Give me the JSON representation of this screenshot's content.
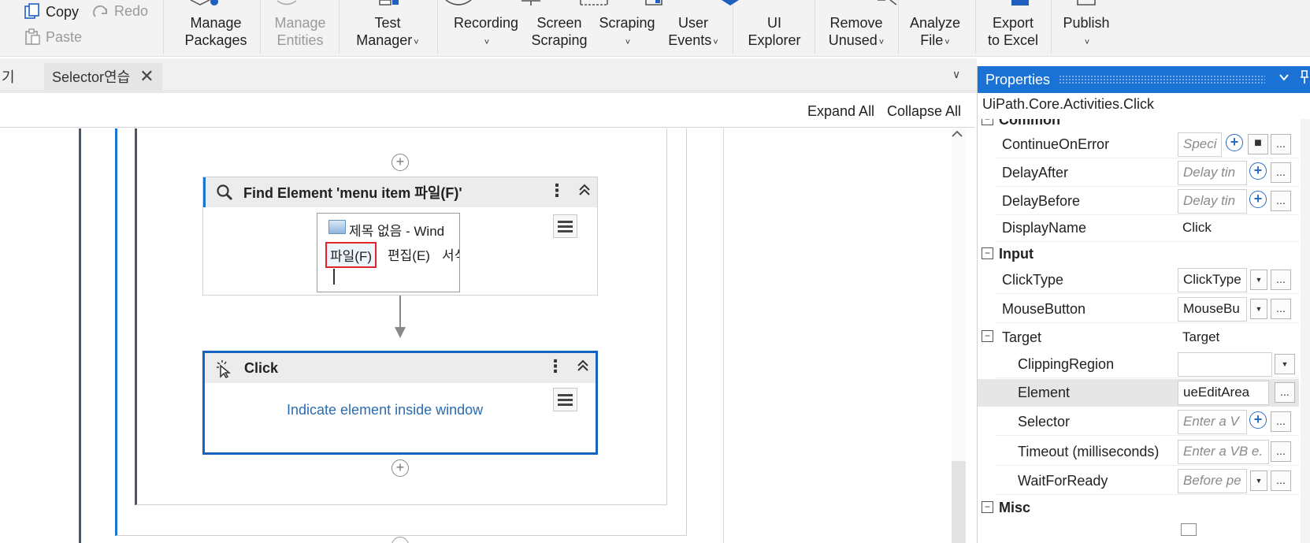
{
  "ribbon": {
    "copy": "Copy",
    "redo": "Redo",
    "paste": "Paste",
    "buttons": [
      {
        "line1": "Manage",
        "line2": "Packages",
        "caret": ""
      },
      {
        "line1": "Manage",
        "line2": "Entities",
        "caret": ""
      },
      {
        "line1": "Test",
        "line2": "Manager",
        "caret": "˅"
      },
      {
        "line1": "Recording",
        "line2": "",
        "caret": "˅"
      },
      {
        "line1": "Screen",
        "line2": "Scraping",
        "caret": ""
      },
      {
        "line1": "Scraping",
        "line2": "",
        "caret": "˅"
      },
      {
        "line1": "User",
        "line2": "Events",
        "caret": "˅"
      },
      {
        "line1": "UI",
        "line2": "Explorer",
        "caret": ""
      },
      {
        "line1": "Remove",
        "line2": "Unused",
        "caret": "˅"
      },
      {
        "line1": "Analyze",
        "line2": "File",
        "caret": "˅"
      },
      {
        "line1": "Export",
        "line2": "to Excel",
        "caret": ""
      },
      {
        "line1": "Publish",
        "line2": "",
        "caret": "˅"
      }
    ]
  },
  "tabs": {
    "prev_partial": "기",
    "active": "Selector연습",
    "close_glyph": "✕",
    "dropdown_glyph": "∨"
  },
  "designer": {
    "expand_all": "Expand All",
    "collapse_all": "Collapse All",
    "find_element": {
      "title": "Find Element 'menu item  파일(F)'",
      "preview_window_title": "제목 없음 - Wind",
      "preview_menu_selected": "파일(F)",
      "preview_menu_item2": "편집(E)",
      "preview_menu_item3": "서식"
    },
    "click_activity": {
      "title": "Click",
      "indicate_link": "Indicate element inside window"
    }
  },
  "properties": {
    "panel_title": "Properties",
    "type_name": "UiPath.Core.Activities.Click",
    "categories": {
      "common": "Common",
      "input": "Input",
      "misc": "Misc"
    },
    "rows": {
      "continue_on_error": {
        "name": "ContinueOnError",
        "value": "Speci"
      },
      "delay_after": {
        "name": "DelayAfter",
        "value": "Delay tin"
      },
      "delay_before": {
        "name": "DelayBefore",
        "value": "Delay tin"
      },
      "display_name": {
        "name": "DisplayName",
        "value": "Click"
      },
      "click_type": {
        "name": "ClickType",
        "value": "ClickType"
      },
      "mouse_button": {
        "name": "MouseButton",
        "value": "MouseBu"
      },
      "target": {
        "name": "Target",
        "value": "Target"
      },
      "clipping_region": {
        "name": "ClippingRegion",
        "value": ""
      },
      "element": {
        "name": "Element",
        "value": "ueEditArea"
      },
      "selector": {
        "name": "Selector",
        "value": "Enter a V"
      },
      "timeout": {
        "name": "Timeout (milliseconds)",
        "value": "Enter a VB e."
      },
      "wait_for_ready": {
        "name": "WaitForReady",
        "value": "Before pe"
      }
    }
  },
  "colors": {
    "accent": "#1a72d4",
    "selected_border": "#1565c0",
    "link": "#2b6cb0",
    "highlight_red": "#e0242b"
  }
}
